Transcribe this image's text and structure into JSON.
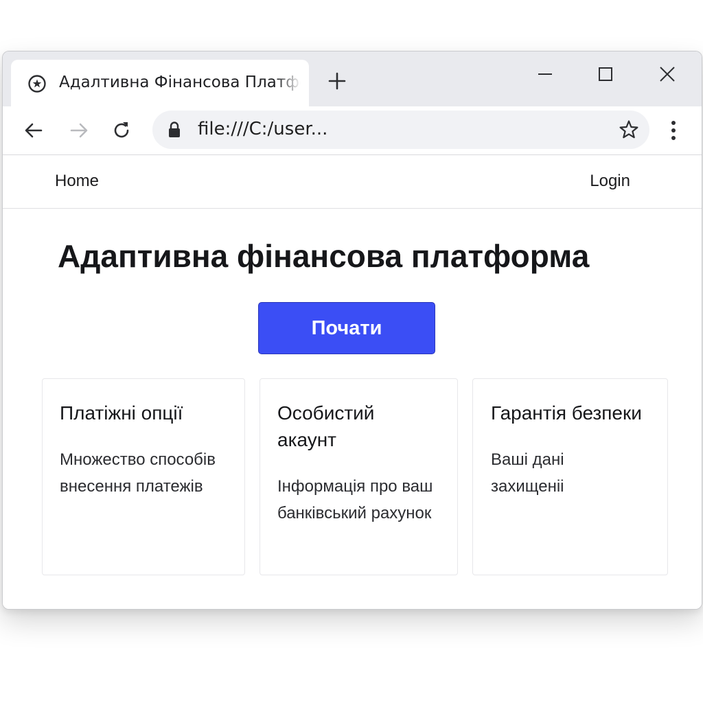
{
  "browser": {
    "tab_title": "Адалтивна Фінансова Платформа",
    "new_tab_label": "+",
    "url": "file:///C:/user..."
  },
  "nav": {
    "home": "Home",
    "login": "Login"
  },
  "hero": {
    "title": "Адаптивна фінансова платформа",
    "button": "Почати"
  },
  "cards": [
    {
      "title": "Платіжні опції",
      "text": "Множество способів внесення платежів"
    },
    {
      "title": "Особистий акаунт",
      "text": "Інформація про ваш банківський рахунок"
    },
    {
      "title": "Гарантія безпеки",
      "text": "Ваші дані захищеніі"
    }
  ],
  "colors": {
    "accent": "#3b4ef5",
    "titlebar": "#e9eaee",
    "omnibox": "#f1f2f5"
  },
  "icons": [
    "favicon-icon",
    "plus-icon",
    "minimize-icon",
    "maximize-icon",
    "close-icon",
    "back-arrow-icon",
    "forward-arrow-icon",
    "reload-icon",
    "lock-icon",
    "star-icon",
    "more-vert-icon"
  ]
}
